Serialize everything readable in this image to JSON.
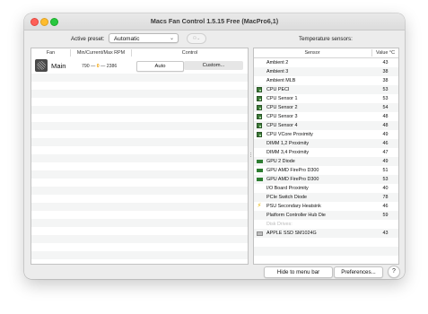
{
  "window": {
    "title": "Macs Fan Control 1.5.15 Free (MacPro6,1)"
  },
  "preset": {
    "label": "Active preset:",
    "value": "Automatic"
  },
  "temperature_title": "Temperature sensors:",
  "fan_table": {
    "headers": {
      "fan": "Fan",
      "rpm": "Min/Current/Max RPM",
      "control": "Control"
    },
    "fans": [
      {
        "name": "Main",
        "min": "790",
        "current": "0",
        "max": "2386",
        "sep": "—",
        "auto_label": "Auto",
        "custom_label": "Custom..."
      }
    ]
  },
  "sensors": {
    "headers": {
      "sensor": "Sensor",
      "value": "Value °C"
    },
    "rows": [
      {
        "name": "Ambient 2",
        "value": "43",
        "icon": "none"
      },
      {
        "name": "Ambient 3",
        "value": "38",
        "icon": "none"
      },
      {
        "name": "Ambient MLB",
        "value": "38",
        "icon": "none"
      },
      {
        "name": "CPU PECI",
        "value": "53",
        "icon": "chip"
      },
      {
        "name": "CPU Sensor 1",
        "value": "53",
        "icon": "chip"
      },
      {
        "name": "CPU Sensor 2",
        "value": "54",
        "icon": "chip"
      },
      {
        "name": "CPU Sensor 3",
        "value": "48",
        "icon": "chip"
      },
      {
        "name": "CPU Sensor 4",
        "value": "48",
        "icon": "chip"
      },
      {
        "name": "CPU VCore Proximity",
        "value": "49",
        "icon": "chip"
      },
      {
        "name": "DIMM 1,2 Proximity",
        "value": "46",
        "icon": "none"
      },
      {
        "name": "DIMM 3,4 Proximity",
        "value": "47",
        "icon": "none"
      },
      {
        "name": "GPU 2 Diode",
        "value": "49",
        "icon": "gpu"
      },
      {
        "name": "GPU AMD FirePro D300",
        "value": "51",
        "icon": "gpu"
      },
      {
        "name": "GPU AMD FirePro D300",
        "value": "53",
        "icon": "gpu"
      },
      {
        "name": "I/O Board Proximity",
        "value": "40",
        "icon": "none"
      },
      {
        "name": "PCIe Switch Diode",
        "value": "78",
        "icon": "none"
      },
      {
        "name": "PSU Secondary Heatsink",
        "value": "46",
        "icon": "bolt"
      },
      {
        "name": "Platform Controller Hub Die",
        "value": "59",
        "icon": "none"
      },
      {
        "name": "Disk Drives:",
        "value": "",
        "icon": "none",
        "dim": true
      },
      {
        "name": "APPLE SSD SM1024G",
        "value": "43",
        "icon": "disk"
      }
    ]
  },
  "buttons": {
    "hide": "Hide to menu bar",
    "preferences": "Preferences...",
    "help": "?"
  }
}
